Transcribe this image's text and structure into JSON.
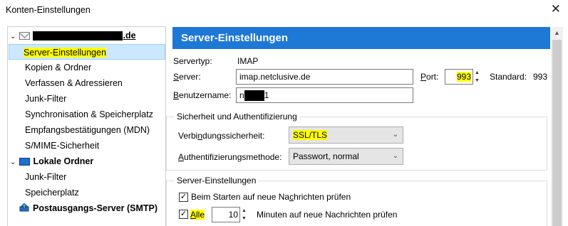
{
  "window": {
    "title": "Konten-Einstellungen",
    "close_glyph": "✕"
  },
  "tree": {
    "account": {
      "name_suffix": ".de",
      "expanded_glyph": "⌄"
    },
    "account_items": [
      "Server-Einstellungen",
      "Kopien & Ordner",
      "Verfassen & Adressieren",
      "Junk-Filter",
      "Synchronisation & Speicherplatz",
      "Empfangsbestätigungen (MDN)",
      "S/MIME-Sicherheit"
    ],
    "local": {
      "label": "Lokale Ordner"
    },
    "local_items": [
      "Junk-Filter",
      "Speicherplatz"
    ],
    "smtp": {
      "label": "Postausgangs-Server (SMTP)"
    }
  },
  "panel": {
    "header": "Server-Einstellungen",
    "servertype_label": "Servertyp:",
    "servertype_value": "IMAP",
    "server_label_u": "S",
    "server_label_rest": "erver:",
    "server_value": "imap.netclusive.de",
    "port_label_u": "P",
    "port_label_rest": "ort:",
    "port_value": "993",
    "standard_label": "Standard:",
    "standard_value": "993",
    "username_label_u": "B",
    "username_label_rest": "enutzername:",
    "username_prefix": "n",
    "username_suffix": "1",
    "security_group": "Sicherheit und Authentifizierung",
    "conn_sec_label_pre": "Verbi",
    "conn_sec_label_u": "n",
    "conn_sec_label_post": "dungssicherheit:",
    "conn_sec_value": "SSL/TLS",
    "auth_label_u": "A",
    "auth_label_rest": "uthentifizierungsmethode:",
    "auth_value": "Passwort, normal",
    "server_group": "Server-Einstellungen",
    "check_new_pre": "Beim Starten auf neue Na",
    "check_new_u": "c",
    "check_new_post": "hrichten prüfen",
    "check_every_u": "A",
    "check_every_rest": "lle",
    "minutes_value": "10",
    "minutes_label": "Minuten auf neue Nachrichten prüfen"
  },
  "colors": {
    "header_bg": "#1e78d5",
    "highlight": "#ffff00",
    "selection": "#cce8ff"
  }
}
